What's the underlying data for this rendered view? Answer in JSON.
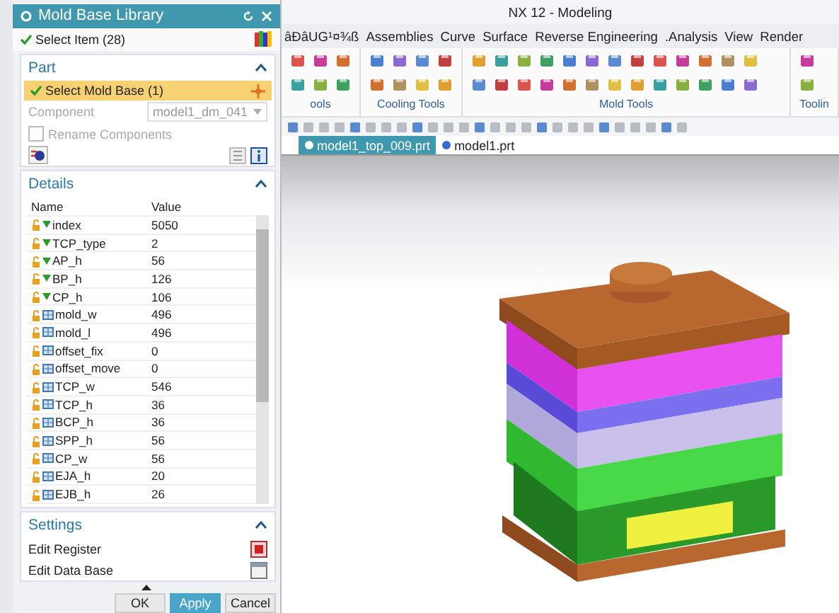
{
  "window": {
    "title": "NX 12 - Modeling"
  },
  "menu": [
    {
      "label": "âĐâUG¹¤¾ß"
    },
    {
      "label": "Assemblies"
    },
    {
      "label": "Curve"
    },
    {
      "label": "Surface"
    },
    {
      "label": "Reverse Engineering"
    },
    {
      "label": ".Analysis"
    },
    {
      "label": "View"
    },
    {
      "label": "Render"
    }
  ],
  "ribbon_groups": [
    {
      "label": "ools"
    },
    {
      "label": "Cooling Tools"
    },
    {
      "label": "Mold Tools"
    },
    {
      "label": "Toolin"
    }
  ],
  "document_tabs": [
    {
      "label": "model1_top_009.prt",
      "selected": true
    },
    {
      "label": "model1.prt",
      "selected": false
    }
  ],
  "dialog": {
    "title": "Mold Base Library",
    "select_item": {
      "label": "Select Item (28)"
    },
    "part": {
      "heading": "Part",
      "expanded": true,
      "select_mold_base": {
        "label": "Select Mold Base (1)",
        "selected": true
      },
      "component": {
        "label": "Component",
        "value": "model1_dm_041",
        "disabled": true
      },
      "rename_components": {
        "label": "Rename Components",
        "checked": false,
        "disabled": true
      }
    },
    "details": {
      "heading": "Details",
      "expanded": true,
      "columns": [
        "Name",
        "Value"
      ],
      "rows": [
        {
          "name": "index",
          "value": "5050",
          "kind": "expression"
        },
        {
          "name": "TCP_type",
          "value": "2",
          "kind": "expression"
        },
        {
          "name": "AP_h",
          "value": "56",
          "kind": "expression"
        },
        {
          "name": "BP_h",
          "value": "126",
          "kind": "expression"
        },
        {
          "name": "CP_h",
          "value": "106",
          "kind": "expression"
        },
        {
          "name": "mold_w",
          "value": "496",
          "kind": "table"
        },
        {
          "name": "mold_l",
          "value": "496",
          "kind": "table"
        },
        {
          "name": "offset_fix",
          "value": "0",
          "kind": "table"
        },
        {
          "name": "offset_move",
          "value": "0",
          "kind": "table"
        },
        {
          "name": "TCP_w",
          "value": "546",
          "kind": "table"
        },
        {
          "name": "TCP_h",
          "value": "36",
          "kind": "table"
        },
        {
          "name": "BCP_h",
          "value": "36",
          "kind": "table"
        },
        {
          "name": "SPP_h",
          "value": "56",
          "kind": "table"
        },
        {
          "name": "CP_w",
          "value": "56",
          "kind": "table"
        },
        {
          "name": "EJA_h",
          "value": "20",
          "kind": "table"
        },
        {
          "name": "EJB_h",
          "value": "26",
          "kind": "table"
        }
      ]
    },
    "settings": {
      "heading": "Settings",
      "expanded": true,
      "items": [
        {
          "label": "Edit Register",
          "kind": "register"
        },
        {
          "label": "Edit Data Base",
          "kind": "database"
        }
      ]
    },
    "buttons": [
      {
        "label": "OK",
        "kind": "normal"
      },
      {
        "label": "Apply",
        "kind": "primary"
      },
      {
        "label": "Cancel",
        "kind": "normal"
      }
    ]
  }
}
